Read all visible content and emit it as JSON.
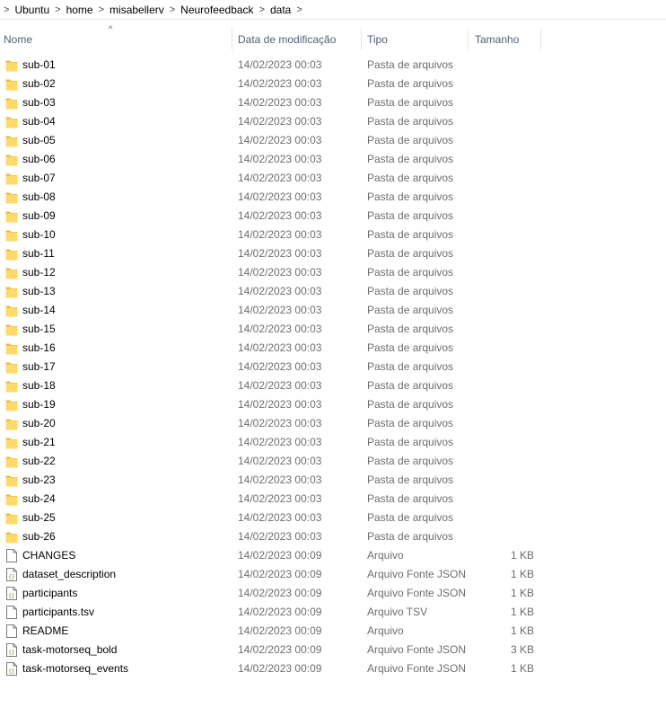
{
  "breadcrumb": {
    "separator": ">",
    "items": [
      "Ubuntu",
      "home",
      "misabellerv",
      "Neurofeedback",
      "data"
    ]
  },
  "columns": {
    "name": "Nome",
    "date": "Data de modificação",
    "type": "Tipo",
    "size": "Tamanho",
    "sort_indicator": "^"
  },
  "files": [
    {
      "name": "sub-01",
      "date": "14/02/2023 00:03",
      "type": "Pasta de arquivos",
      "size": "",
      "icon": "folder-icon"
    },
    {
      "name": "sub-02",
      "date": "14/02/2023 00:03",
      "type": "Pasta de arquivos",
      "size": "",
      "icon": "folder-icon"
    },
    {
      "name": "sub-03",
      "date": "14/02/2023 00:03",
      "type": "Pasta de arquivos",
      "size": "",
      "icon": "folder-icon"
    },
    {
      "name": "sub-04",
      "date": "14/02/2023 00:03",
      "type": "Pasta de arquivos",
      "size": "",
      "icon": "folder-icon"
    },
    {
      "name": "sub-05",
      "date": "14/02/2023 00:03",
      "type": "Pasta de arquivos",
      "size": "",
      "icon": "folder-icon"
    },
    {
      "name": "sub-06",
      "date": "14/02/2023 00:03",
      "type": "Pasta de arquivos",
      "size": "",
      "icon": "folder-icon"
    },
    {
      "name": "sub-07",
      "date": "14/02/2023 00:03",
      "type": "Pasta de arquivos",
      "size": "",
      "icon": "folder-icon"
    },
    {
      "name": "sub-08",
      "date": "14/02/2023 00:03",
      "type": "Pasta de arquivos",
      "size": "",
      "icon": "folder-icon"
    },
    {
      "name": "sub-09",
      "date": "14/02/2023 00:03",
      "type": "Pasta de arquivos",
      "size": "",
      "icon": "folder-icon"
    },
    {
      "name": "sub-10",
      "date": "14/02/2023 00:03",
      "type": "Pasta de arquivos",
      "size": "",
      "icon": "folder-icon"
    },
    {
      "name": "sub-11",
      "date": "14/02/2023 00:03",
      "type": "Pasta de arquivos",
      "size": "",
      "icon": "folder-icon"
    },
    {
      "name": "sub-12",
      "date": "14/02/2023 00:03",
      "type": "Pasta de arquivos",
      "size": "",
      "icon": "folder-icon"
    },
    {
      "name": "sub-13",
      "date": "14/02/2023 00:03",
      "type": "Pasta de arquivos",
      "size": "",
      "icon": "folder-icon"
    },
    {
      "name": "sub-14",
      "date": "14/02/2023 00:03",
      "type": "Pasta de arquivos",
      "size": "",
      "icon": "folder-icon"
    },
    {
      "name": "sub-15",
      "date": "14/02/2023 00:03",
      "type": "Pasta de arquivos",
      "size": "",
      "icon": "folder-icon"
    },
    {
      "name": "sub-16",
      "date": "14/02/2023 00:03",
      "type": "Pasta de arquivos",
      "size": "",
      "icon": "folder-icon"
    },
    {
      "name": "sub-17",
      "date": "14/02/2023 00:03",
      "type": "Pasta de arquivos",
      "size": "",
      "icon": "folder-icon"
    },
    {
      "name": "sub-18",
      "date": "14/02/2023 00:03",
      "type": "Pasta de arquivos",
      "size": "",
      "icon": "folder-icon"
    },
    {
      "name": "sub-19",
      "date": "14/02/2023 00:03",
      "type": "Pasta de arquivos",
      "size": "",
      "icon": "folder-icon"
    },
    {
      "name": "sub-20",
      "date": "14/02/2023 00:03",
      "type": "Pasta de arquivos",
      "size": "",
      "icon": "folder-icon"
    },
    {
      "name": "sub-21",
      "date": "14/02/2023 00:03",
      "type": "Pasta de arquivos",
      "size": "",
      "icon": "folder-icon"
    },
    {
      "name": "sub-22",
      "date": "14/02/2023 00:03",
      "type": "Pasta de arquivos",
      "size": "",
      "icon": "folder-icon"
    },
    {
      "name": "sub-23",
      "date": "14/02/2023 00:03",
      "type": "Pasta de arquivos",
      "size": "",
      "icon": "folder-icon"
    },
    {
      "name": "sub-24",
      "date": "14/02/2023 00:03",
      "type": "Pasta de arquivos",
      "size": "",
      "icon": "folder-icon"
    },
    {
      "name": "sub-25",
      "date": "14/02/2023 00:03",
      "type": "Pasta de arquivos",
      "size": "",
      "icon": "folder-icon"
    },
    {
      "name": "sub-26",
      "date": "14/02/2023 00:03",
      "type": "Pasta de arquivos",
      "size": "",
      "icon": "folder-icon"
    },
    {
      "name": "CHANGES",
      "date": "14/02/2023 00:09",
      "type": "Arquivo",
      "size": "1 KB",
      "icon": "file-icon"
    },
    {
      "name": "dataset_description",
      "date": "14/02/2023 00:09",
      "type": "Arquivo Fonte JSON",
      "size": "1 KB",
      "icon": "json-file-icon"
    },
    {
      "name": "participants",
      "date": "14/02/2023 00:09",
      "type": "Arquivo Fonte JSON",
      "size": "1 KB",
      "icon": "json-file-icon"
    },
    {
      "name": "participants.tsv",
      "date": "14/02/2023 00:09",
      "type": "Arquivo TSV",
      "size": "1 KB",
      "icon": "file-icon"
    },
    {
      "name": "README",
      "date": "14/02/2023 00:09",
      "type": "Arquivo",
      "size": "1 KB",
      "icon": "file-icon"
    },
    {
      "name": "task-motorseq_bold",
      "date": "14/02/2023 00:09",
      "type": "Arquivo Fonte JSON",
      "size": "3 KB",
      "icon": "json-file-icon"
    },
    {
      "name": "task-motorseq_events",
      "date": "14/02/2023 00:09",
      "type": "Arquivo Fonte JSON",
      "size": "1 KB",
      "icon": "json-file-icon"
    }
  ],
  "colors": {
    "folder_fill": "#ffd96a",
    "folder_tab": "#e8b83a",
    "header_text": "#4c607a",
    "secondary_text": "#6d6d6d"
  }
}
